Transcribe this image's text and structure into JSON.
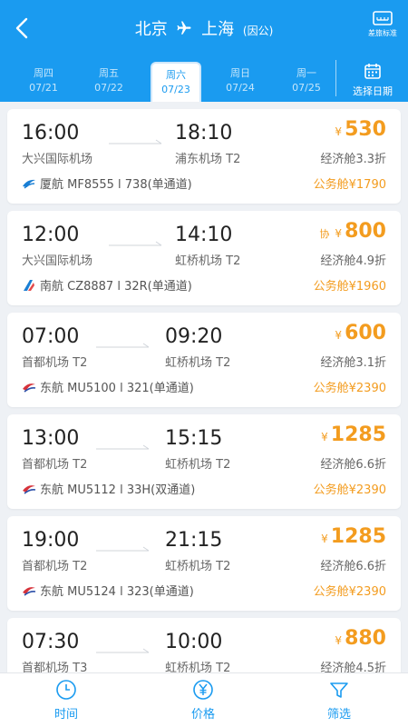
{
  "header": {
    "from": "北京",
    "to": "上海",
    "tag": "(因公)",
    "policy_label": "差旅标准",
    "icons": {
      "back": "back-arrow-icon",
      "plane": "plane-icon",
      "policy": "policy-card-icon"
    }
  },
  "dates": [
    {
      "weekday": "周四",
      "date": "07/21"
    },
    {
      "weekday": "周五",
      "date": "07/22"
    },
    {
      "weekday": "周六",
      "date": "07/23"
    },
    {
      "weekday": "周日",
      "date": "07/24"
    },
    {
      "weekday": "周一",
      "date": "07/25"
    }
  ],
  "selected_date_index": 2,
  "pick_date_label": "选择日期",
  "flights": [
    {
      "dep_time": "16:00",
      "arr_time": "18:10",
      "dep_airport": "大兴国际机场",
      "arr_airport": "浦东机场 T2",
      "currency": "¥",
      "price": "530",
      "xie": "",
      "economy": "经济舱3.3折",
      "airline": "厦航 MF8555 l 738(单通道)",
      "airline_logo": "xiamen-air-logo-icon",
      "business": "公务舱¥1790"
    },
    {
      "dep_time": "12:00",
      "arr_time": "14:10",
      "dep_airport": "大兴国际机场",
      "arr_airport": "虹桥机场 T2",
      "currency": "¥",
      "price": "800",
      "xie": "协",
      "economy": "经济舱4.9折",
      "airline": "南航 CZ8887 l 32R(单通道)",
      "airline_logo": "china-southern-logo-icon",
      "business": "公务舱¥1960"
    },
    {
      "dep_time": "07:00",
      "arr_time": "09:20",
      "dep_airport": "首都机场 T2",
      "arr_airport": "虹桥机场 T2",
      "currency": "¥",
      "price": "600",
      "xie": "",
      "economy": "经济舱3.1折",
      "airline": "东航 MU5100 l 321(单通道)",
      "airline_logo": "china-eastern-logo-icon",
      "business": "公务舱¥2390"
    },
    {
      "dep_time": "13:00",
      "arr_time": "15:15",
      "dep_airport": "首都机场 T2",
      "arr_airport": "虹桥机场 T2",
      "currency": "¥",
      "price": "1285",
      "xie": "",
      "economy": "经济舱6.6折",
      "airline": "东航 MU5112 l 33H(双通道)",
      "airline_logo": "china-eastern-logo-icon",
      "business": "公务舱¥2390"
    },
    {
      "dep_time": "19:00",
      "arr_time": "21:15",
      "dep_airport": "首都机场 T2",
      "arr_airport": "虹桥机场 T2",
      "currency": "¥",
      "price": "1285",
      "xie": "",
      "economy": "经济舱6.6折",
      "airline": "东航 MU5124 l 323(单通道)",
      "airline_logo": "china-eastern-logo-icon",
      "business": "公务舱¥2390"
    },
    {
      "dep_time": "07:30",
      "arr_time": "10:00",
      "dep_airport": "首都机场 T3",
      "arr_airport": "虹桥机场 T2",
      "currency": "¥",
      "price": "880",
      "xie": "",
      "economy": "经济舱4.5折",
      "airline": "",
      "airline_logo": "",
      "business": ""
    }
  ],
  "bottom_bar": [
    {
      "label": "时间",
      "icon": "clock-icon"
    },
    {
      "label": "价格",
      "icon": "yen-icon"
    },
    {
      "label": "筛选",
      "icon": "filter-icon"
    }
  ],
  "colors": {
    "primary": "#1a9bf0",
    "price": "#f39c1f",
    "background": "#eef1f5"
  }
}
